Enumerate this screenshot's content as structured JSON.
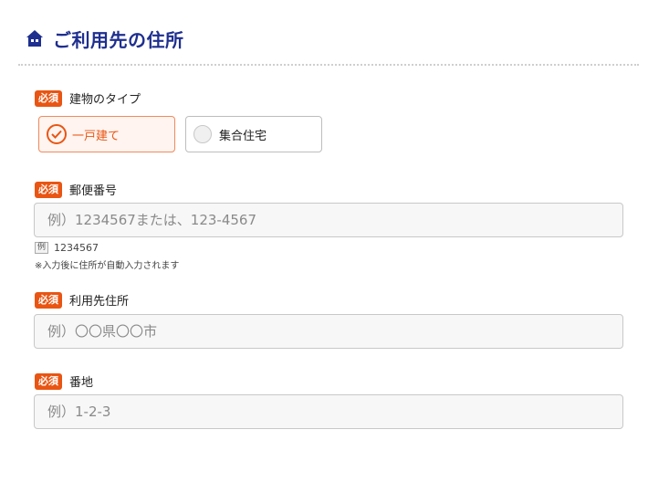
{
  "header": {
    "title": "ご利用先の住所",
    "icon": "house-icon",
    "title_color": "#1f2f8f"
  },
  "required_badge": "必須",
  "building_type": {
    "label": "建物のタイプ",
    "options": [
      {
        "label": "一戸建て",
        "selected": true
      },
      {
        "label": "集合住宅",
        "selected": false
      }
    ]
  },
  "postal_code": {
    "label": "郵便番号",
    "placeholder": "例）1234567または、123-4567",
    "value": "",
    "example_tag": "例",
    "example_value": "1234567",
    "note": "※入力後に住所が自動入力されます"
  },
  "address": {
    "label": "利用先住所",
    "placeholder": "例）〇〇県〇〇市",
    "value": ""
  },
  "street_number": {
    "label": "番地",
    "placeholder": "例）1-2-3",
    "value": ""
  },
  "colors": {
    "accent": "#e95513",
    "selected_bg": "#fff4ef",
    "input_bg": "#f7f7f7"
  }
}
